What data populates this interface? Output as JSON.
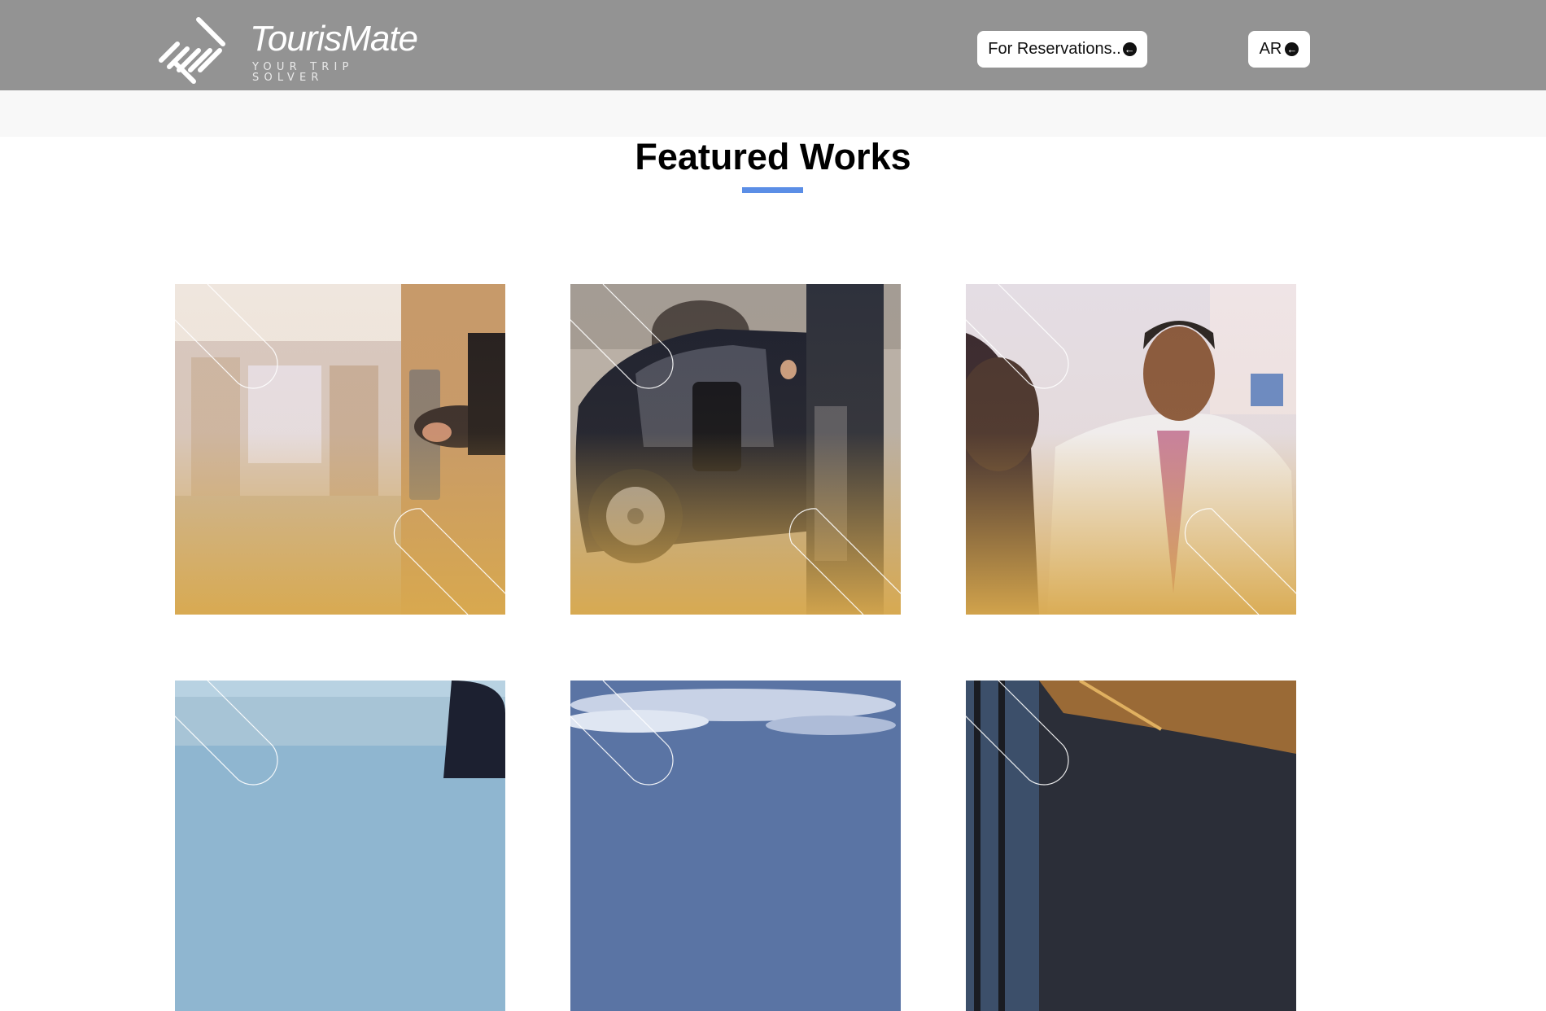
{
  "brand": {
    "name": "TourisMate",
    "tagline": "YOUR TRIP SOLVER"
  },
  "header": {
    "reservations_label": "For Reservations..",
    "language_label": "AR",
    "arrow_icon": "circle-arrow-left-icon"
  },
  "section": {
    "title": "Featured Works",
    "accent_color": "#5b8ee6"
  },
  "colors": {
    "header_bg": "#939393",
    "card_gradient_end": "#d9a94d"
  },
  "works": [
    {
      "name": "hotel-door-photo"
    },
    {
      "name": "chauffeur-car-photo"
    },
    {
      "name": "doctor-consultation-photo"
    },
    {
      "name": "office-meeting-photo"
    },
    {
      "name": "sky-clouds-photo"
    },
    {
      "name": "building-facade-photo"
    }
  ]
}
